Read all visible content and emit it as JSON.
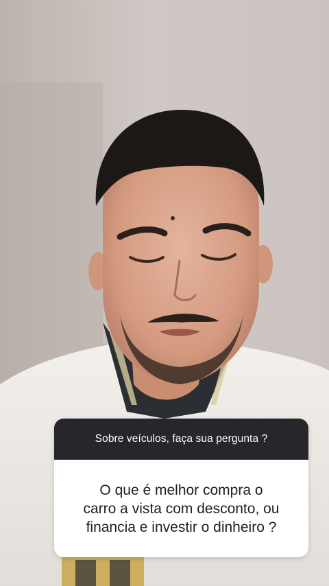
{
  "story": {
    "question_prompt": "Sobre veículos, faça sua pergunta ?",
    "question_text": "O que é melhor compra o\ncarro a vista com desconto, ou\nfinancia e investir o dinheiro ?"
  }
}
